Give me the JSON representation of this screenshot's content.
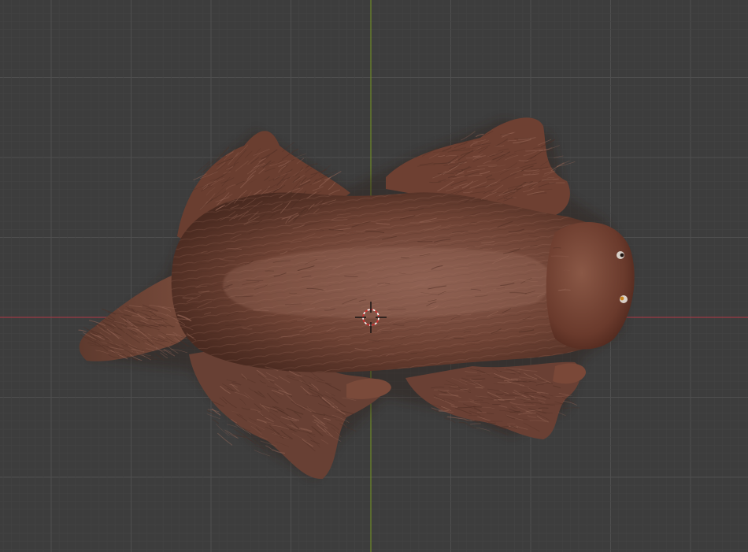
{
  "viewport": {
    "view": "top-orthographic",
    "background_color": "#3d3d3d",
    "grid_minor_color": "#444444",
    "grid_major_color": "#4f4f4f",
    "axis_x_color": "#9b3a44",
    "axis_y_color": "#6f8a28",
    "show_grid": true,
    "show_axes": true
  },
  "object": {
    "kind": "furry-animal-mesh",
    "fur_color": "#7a4a3c",
    "fur_highlight": "#9a6a5a",
    "fur_shadow": "#4e2e24",
    "head_color": "#6a3a2c"
  },
  "cursor": {
    "kind": "3d-cursor-icon"
  }
}
